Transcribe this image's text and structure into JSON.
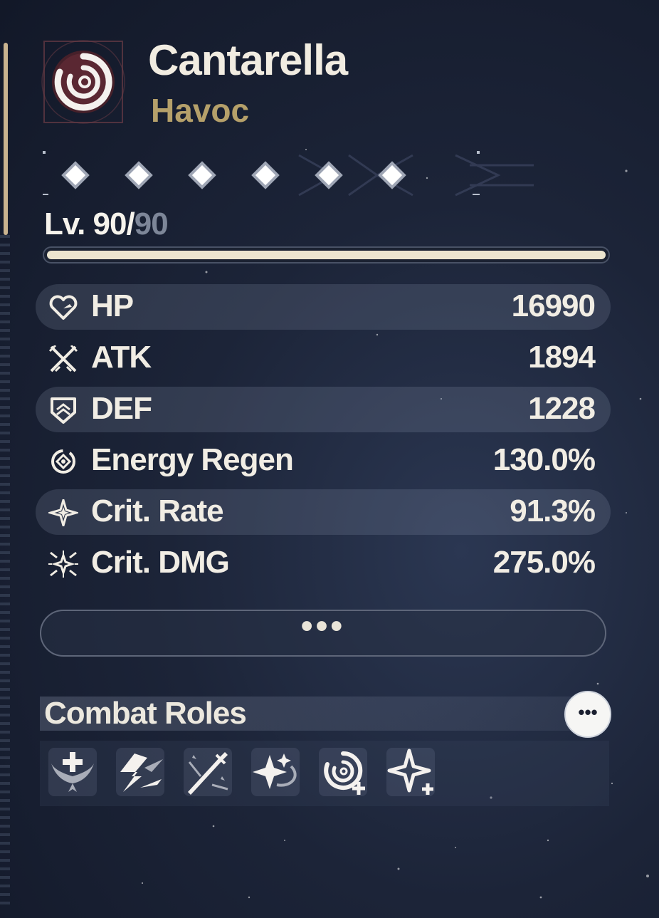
{
  "character": {
    "name": "Cantarella",
    "element": "Havoc",
    "element_color": "#b5a06a",
    "emblem_icon": "havoc-spiral-icon",
    "sequence_nodes": 6,
    "level_label": "Lv. ",
    "level_current": "90",
    "level_separator": "/",
    "level_max": "90",
    "level_progress": 1.0
  },
  "stats": [
    {
      "icon": "heart-icon",
      "label": "HP",
      "value": "16990"
    },
    {
      "icon": "crossed-swords-icon",
      "label": "ATK",
      "value": "1894"
    },
    {
      "icon": "shield-icon",
      "label": "DEF",
      "value": "1228"
    },
    {
      "icon": "energy-regen-icon",
      "label": "Energy Regen",
      "value": "130.0%"
    },
    {
      "icon": "crit-rate-icon",
      "label": "Crit. Rate",
      "value": "91.3%"
    },
    {
      "icon": "crit-dmg-icon",
      "label": "Crit. DMG",
      "value": "275.0%"
    }
  ],
  "more_button": "•••",
  "combat_roles": {
    "title": "Combat Roles",
    "more_button": "•••",
    "roles": [
      {
        "icon": "healing-wings-icon"
      },
      {
        "icon": "lightning-strike-icon"
      },
      {
        "icon": "sword-slash-icon"
      },
      {
        "icon": "sparkle-swirl-icon"
      },
      {
        "icon": "havoc-spiral-plus-icon"
      },
      {
        "icon": "star-plus-icon"
      }
    ]
  },
  "colors": {
    "background": "#1c2438",
    "accent_gold": "#c9b38f",
    "text": "#f1ede4",
    "level_bar": "#ece5cf"
  }
}
